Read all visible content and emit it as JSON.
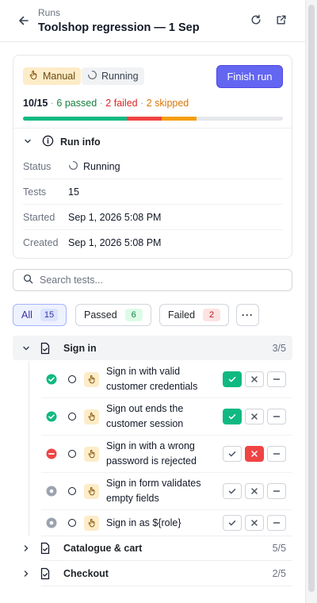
{
  "header": {
    "breadcrumb": "Runs",
    "title": "Toolshop regression — 1 Sep"
  },
  "run": {
    "type_badge": "Manual",
    "state_badge": "Running",
    "finish_label": "Finish run",
    "summary": {
      "progress": "10/15",
      "passed": "6 passed",
      "failed": "2 failed",
      "skipped": "2 skipped",
      "sep": "·"
    },
    "progress_bar": {
      "total": 15,
      "passed": 6,
      "failed": 2,
      "skipped": 2,
      "colors": {
        "passed": "#10b981",
        "failed": "#ef4444",
        "skipped": "#f59e0b"
      }
    }
  },
  "run_info": {
    "heading": "Run info",
    "rows": [
      {
        "key": "Status",
        "value": "Running"
      },
      {
        "key": "Tests",
        "value": "15"
      },
      {
        "key": "Started",
        "value": "Sep 1, 2026 5:08 PM"
      },
      {
        "key": "Created",
        "value": "Sep 1, 2026 5:08 PM"
      }
    ]
  },
  "search": {
    "placeholder": "Search tests...",
    "value": ""
  },
  "filters": [
    {
      "label": "All",
      "count": "15"
    },
    {
      "label": "Passed",
      "count": "6"
    },
    {
      "label": "Failed",
      "count": "2"
    }
  ],
  "more_label": "···",
  "groups": [
    {
      "name": "Sign in",
      "count": "3/5",
      "expanded": true
    },
    {
      "name": "Catalogue & cart",
      "count": "5/5",
      "expanded": false
    },
    {
      "name": "Checkout",
      "count": "2/5",
      "expanded": false
    }
  ],
  "cases": [
    {
      "name": "Sign in with valid customer credentials",
      "status": "passed"
    },
    {
      "name": "Sign out ends the customer session",
      "status": "passed"
    },
    {
      "name": "Sign in with a wrong password is rejected",
      "status": "failed"
    },
    {
      "name": "Sign in form validates empty fields",
      "status": "skipped"
    },
    {
      "name": "Sign in as ${role}",
      "status": "skipped"
    }
  ],
  "icons": {
    "back": "arrow-left-icon",
    "refresh": "refresh-icon",
    "open": "external-link-icon",
    "manual": "hand-pointer-icon",
    "spinner": "spinner-icon",
    "info": "info-icon",
    "search": "search-icon",
    "test": "document-check-icon"
  }
}
